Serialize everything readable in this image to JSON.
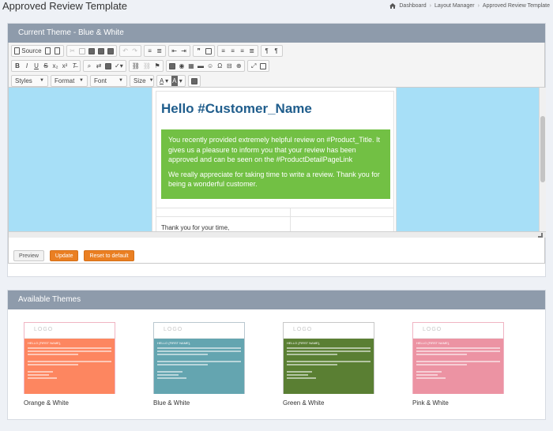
{
  "header": {
    "title": "Approved Review Template",
    "breadcrumb": [
      "Dashboard",
      "Layout Manager",
      "Approved Review Template"
    ]
  },
  "current_theme": {
    "panel_title": "Current Theme - Blue & White"
  },
  "toolbar": {
    "source_label": "Source",
    "styles_label": "Styles",
    "format_label": "Format",
    "font_label": "Font",
    "size_label": "Size"
  },
  "email": {
    "heading": "Hello #Customer_Name",
    "paragraph1": "You recently provided extremely helpful review on #Product_Title. It gives us a pleasure to inform you that your review has been approved and can be seen on the #ProductDetailPageLink",
    "paragraph2": "We really appreciate for taking time to write a review. Thank you for being a wonderful customer.",
    "thanks": "Thank you for your time,"
  },
  "actions": {
    "preview": "Preview",
    "update": "Update",
    "reset": "Reset to default"
  },
  "available": {
    "panel_title": "Available Themes",
    "logo_text": "LOGO",
    "thumb_greeting": "HELLO {FIRST NAME},",
    "themes": [
      {
        "name": "Orange & White",
        "color": "#fd8660",
        "border": "#f0b4c3"
      },
      {
        "name": "Blue & White",
        "color": "#64a5b0",
        "border": "#b9c7cf"
      },
      {
        "name": "Green & White",
        "color": "#5a7f33",
        "border": "#c7c7c7"
      },
      {
        "name": "Pink & White",
        "color": "#ec93a3",
        "border": "#f0b4c3"
      }
    ]
  },
  "colors": {
    "panel_header": "#8e9bab",
    "editor_bg": "#a7dff7",
    "email_heading": "#1f5d8c",
    "email_box": "#72c044",
    "button_accent": "#ea7f22"
  }
}
